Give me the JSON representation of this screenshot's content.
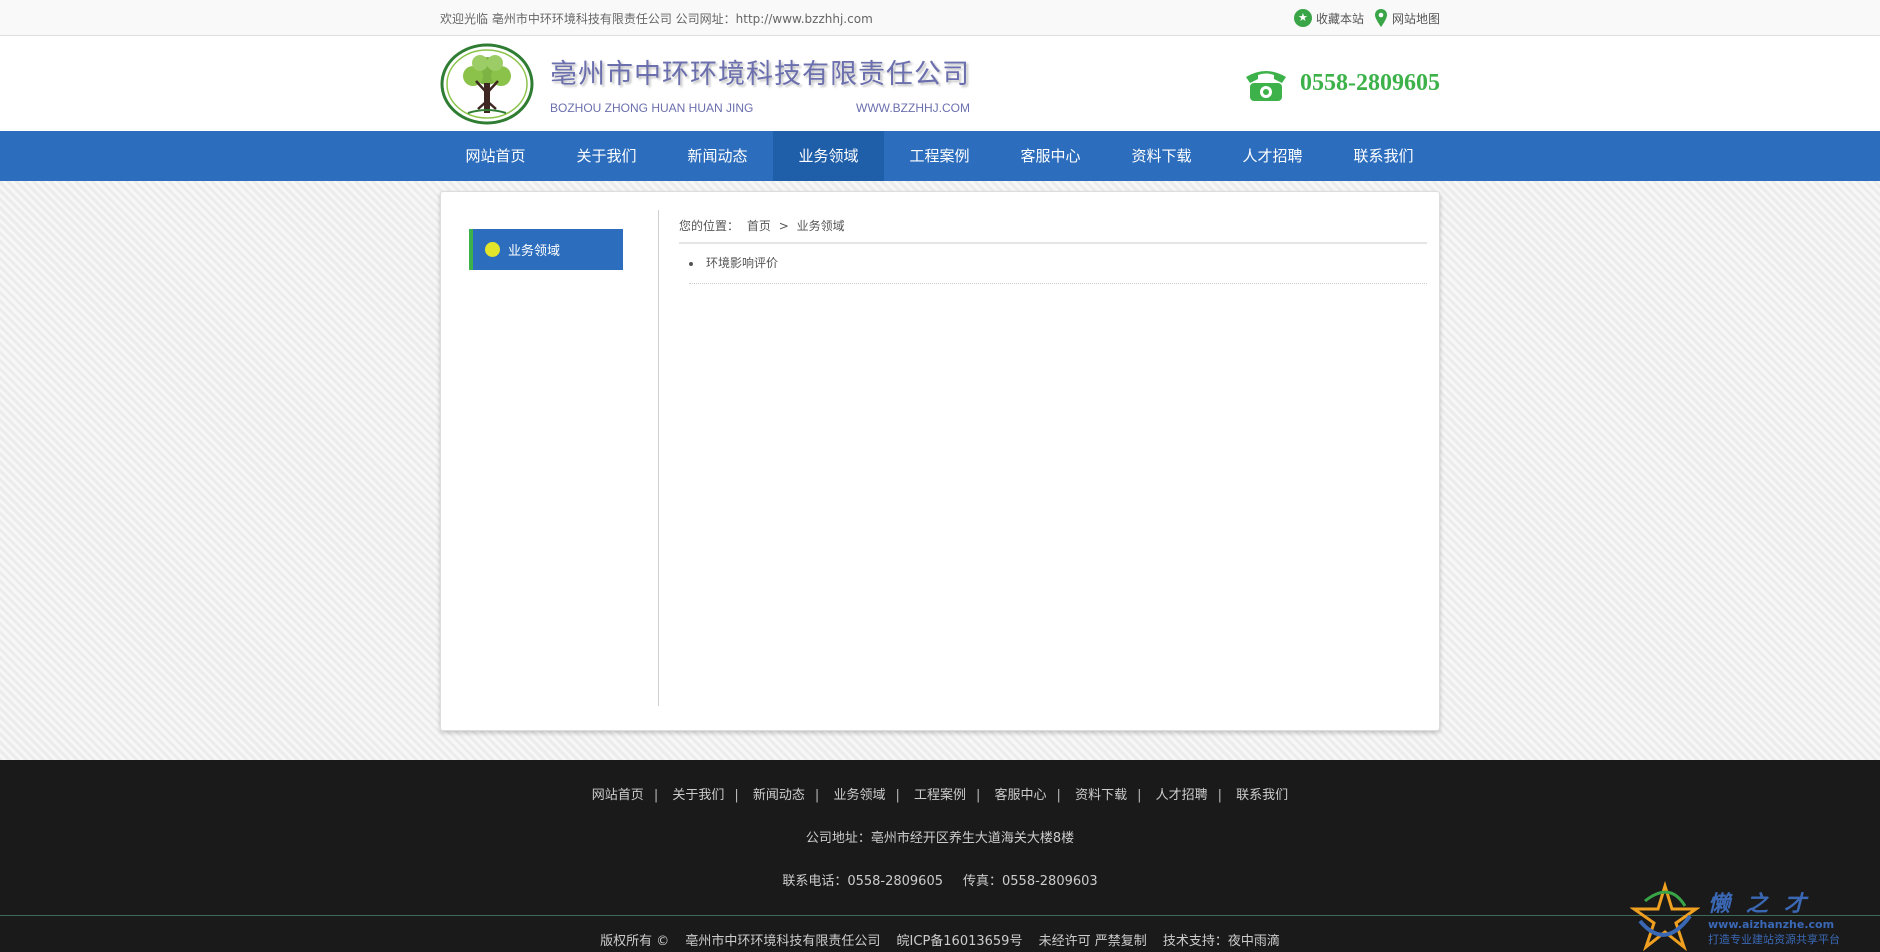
{
  "topbar": {
    "welcome": "欢迎光临 亳州市中环环境科技有限责任公司 公司网址：http://www.bzzhhj.com",
    "favorite": "收藏本站",
    "sitemap": "网站地图"
  },
  "header": {
    "company_cn": "亳州市中环环境科技有限责任公司",
    "company_en": "BOZHOU ZHONG HUAN HUAN JING",
    "domain": "WWW.BZZHHJ.COM",
    "phone": "0558-2809605"
  },
  "nav": {
    "items": [
      "网站首页",
      "关于我们",
      "新闻动态",
      "业务领域",
      "工程案例",
      "客服中心",
      "资料下载",
      "人才招聘",
      "联系我们"
    ],
    "active_index": 3
  },
  "sidebar": {
    "title": "业务领域"
  },
  "breadcrumb": {
    "prefix": "您的位置：",
    "home": "首页",
    "separator": ">",
    "current": "业务领域"
  },
  "content": {
    "items": [
      "环境影响评价"
    ]
  },
  "footer": {
    "nav": [
      "网站首页",
      "关于我们",
      "新闻动态",
      "业务领域",
      "工程案例",
      "客服中心",
      "资料下载",
      "人才招聘",
      "联系我们"
    ],
    "address": "公司地址：亳州市经开区养生大道海关大楼8楼",
    "tel": "联系电话：0558-2809605",
    "fax": "传真：0558-2809603",
    "copyright": "版权所有 ©",
    "company": "亳州市中环环境科技有限责任公司",
    "icp": "皖ICP备16013659号",
    "notice": "未经许可 严禁复制",
    "support": "技术支持：夜中雨滴"
  },
  "watermark": {
    "title": "懒之才",
    "url": "www.aizhanzhe.com",
    "slogan": "打造专业建站资源共享平台"
  },
  "colors": {
    "nav_bg": "#2c6ebd",
    "accent_green": "#3eb24a",
    "footer_bg": "#1a1a1a"
  }
}
